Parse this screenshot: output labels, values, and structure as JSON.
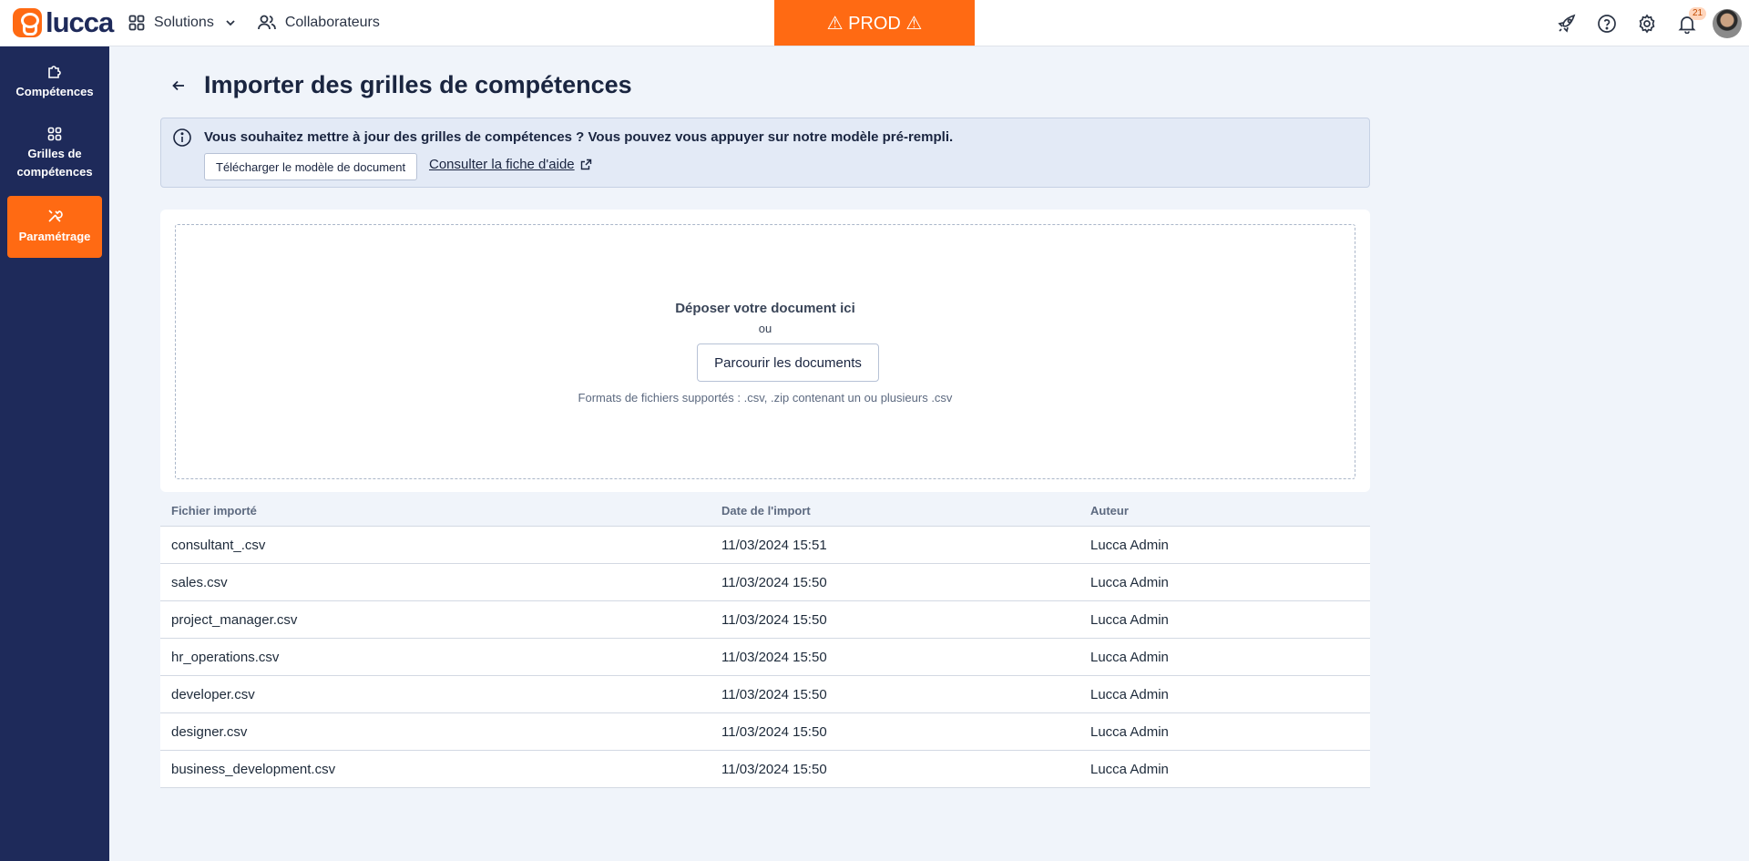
{
  "topbar": {
    "logo_text": "lucca",
    "nav": [
      {
        "label": "Solutions",
        "icon": "grid-icon"
      },
      {
        "label": "Collaborateurs",
        "icon": "users-icon"
      }
    ],
    "env_banner": "⚠ PROD ⚠",
    "icons": [
      "rocket-icon",
      "help-icon",
      "gear-icon",
      "bell-icon"
    ],
    "notification_count": "21"
  },
  "sidebar": {
    "items": [
      {
        "label": "Compétences",
        "icon": "puzzle-icon",
        "active": false
      },
      {
        "label": "Grilles de compétences",
        "icon": "grid-icon",
        "active": false
      },
      {
        "label": "Paramétrage",
        "icon": "tools-icon",
        "active": true
      }
    ]
  },
  "page": {
    "title": "Importer des grilles de compétences"
  },
  "info": {
    "text": "Vous souhaitez mettre à jour des grilles de compétences ? Vous pouvez vous appuyer sur notre modèle pré-rempli.",
    "download_button": "Télécharger le modèle de document",
    "help_link": "Consulter la fiche d'aide"
  },
  "dropzone": {
    "title": "Déposer votre document ici",
    "or": "ou",
    "browse_button": "Parcourir les documents",
    "formats": "Formats de fichiers supportés : .csv, .zip contenant un ou plusieurs .csv"
  },
  "table": {
    "headers": [
      "Fichier importé",
      "Date de l'import",
      "Auteur"
    ],
    "rows": [
      [
        "consultant_.csv",
        "11/03/2024 15:51",
        "Lucca Admin"
      ],
      [
        "sales.csv",
        "11/03/2024 15:50",
        "Lucca Admin"
      ],
      [
        "project_manager.csv",
        "11/03/2024 15:50",
        "Lucca Admin"
      ],
      [
        "hr_operations.csv",
        "11/03/2024 15:50",
        "Lucca Admin"
      ],
      [
        "developer.csv",
        "11/03/2024 15:50",
        "Lucca Admin"
      ],
      [
        "designer.csv",
        "11/03/2024 15:50",
        "Lucca Admin"
      ],
      [
        "business_development.csv",
        "11/03/2024 15:50",
        "Lucca Admin"
      ]
    ]
  },
  "colors": {
    "brand_orange": "#ff6a13",
    "sidebar_navy": "#1e2a5a",
    "page_bg": "#f0f4fa"
  }
}
